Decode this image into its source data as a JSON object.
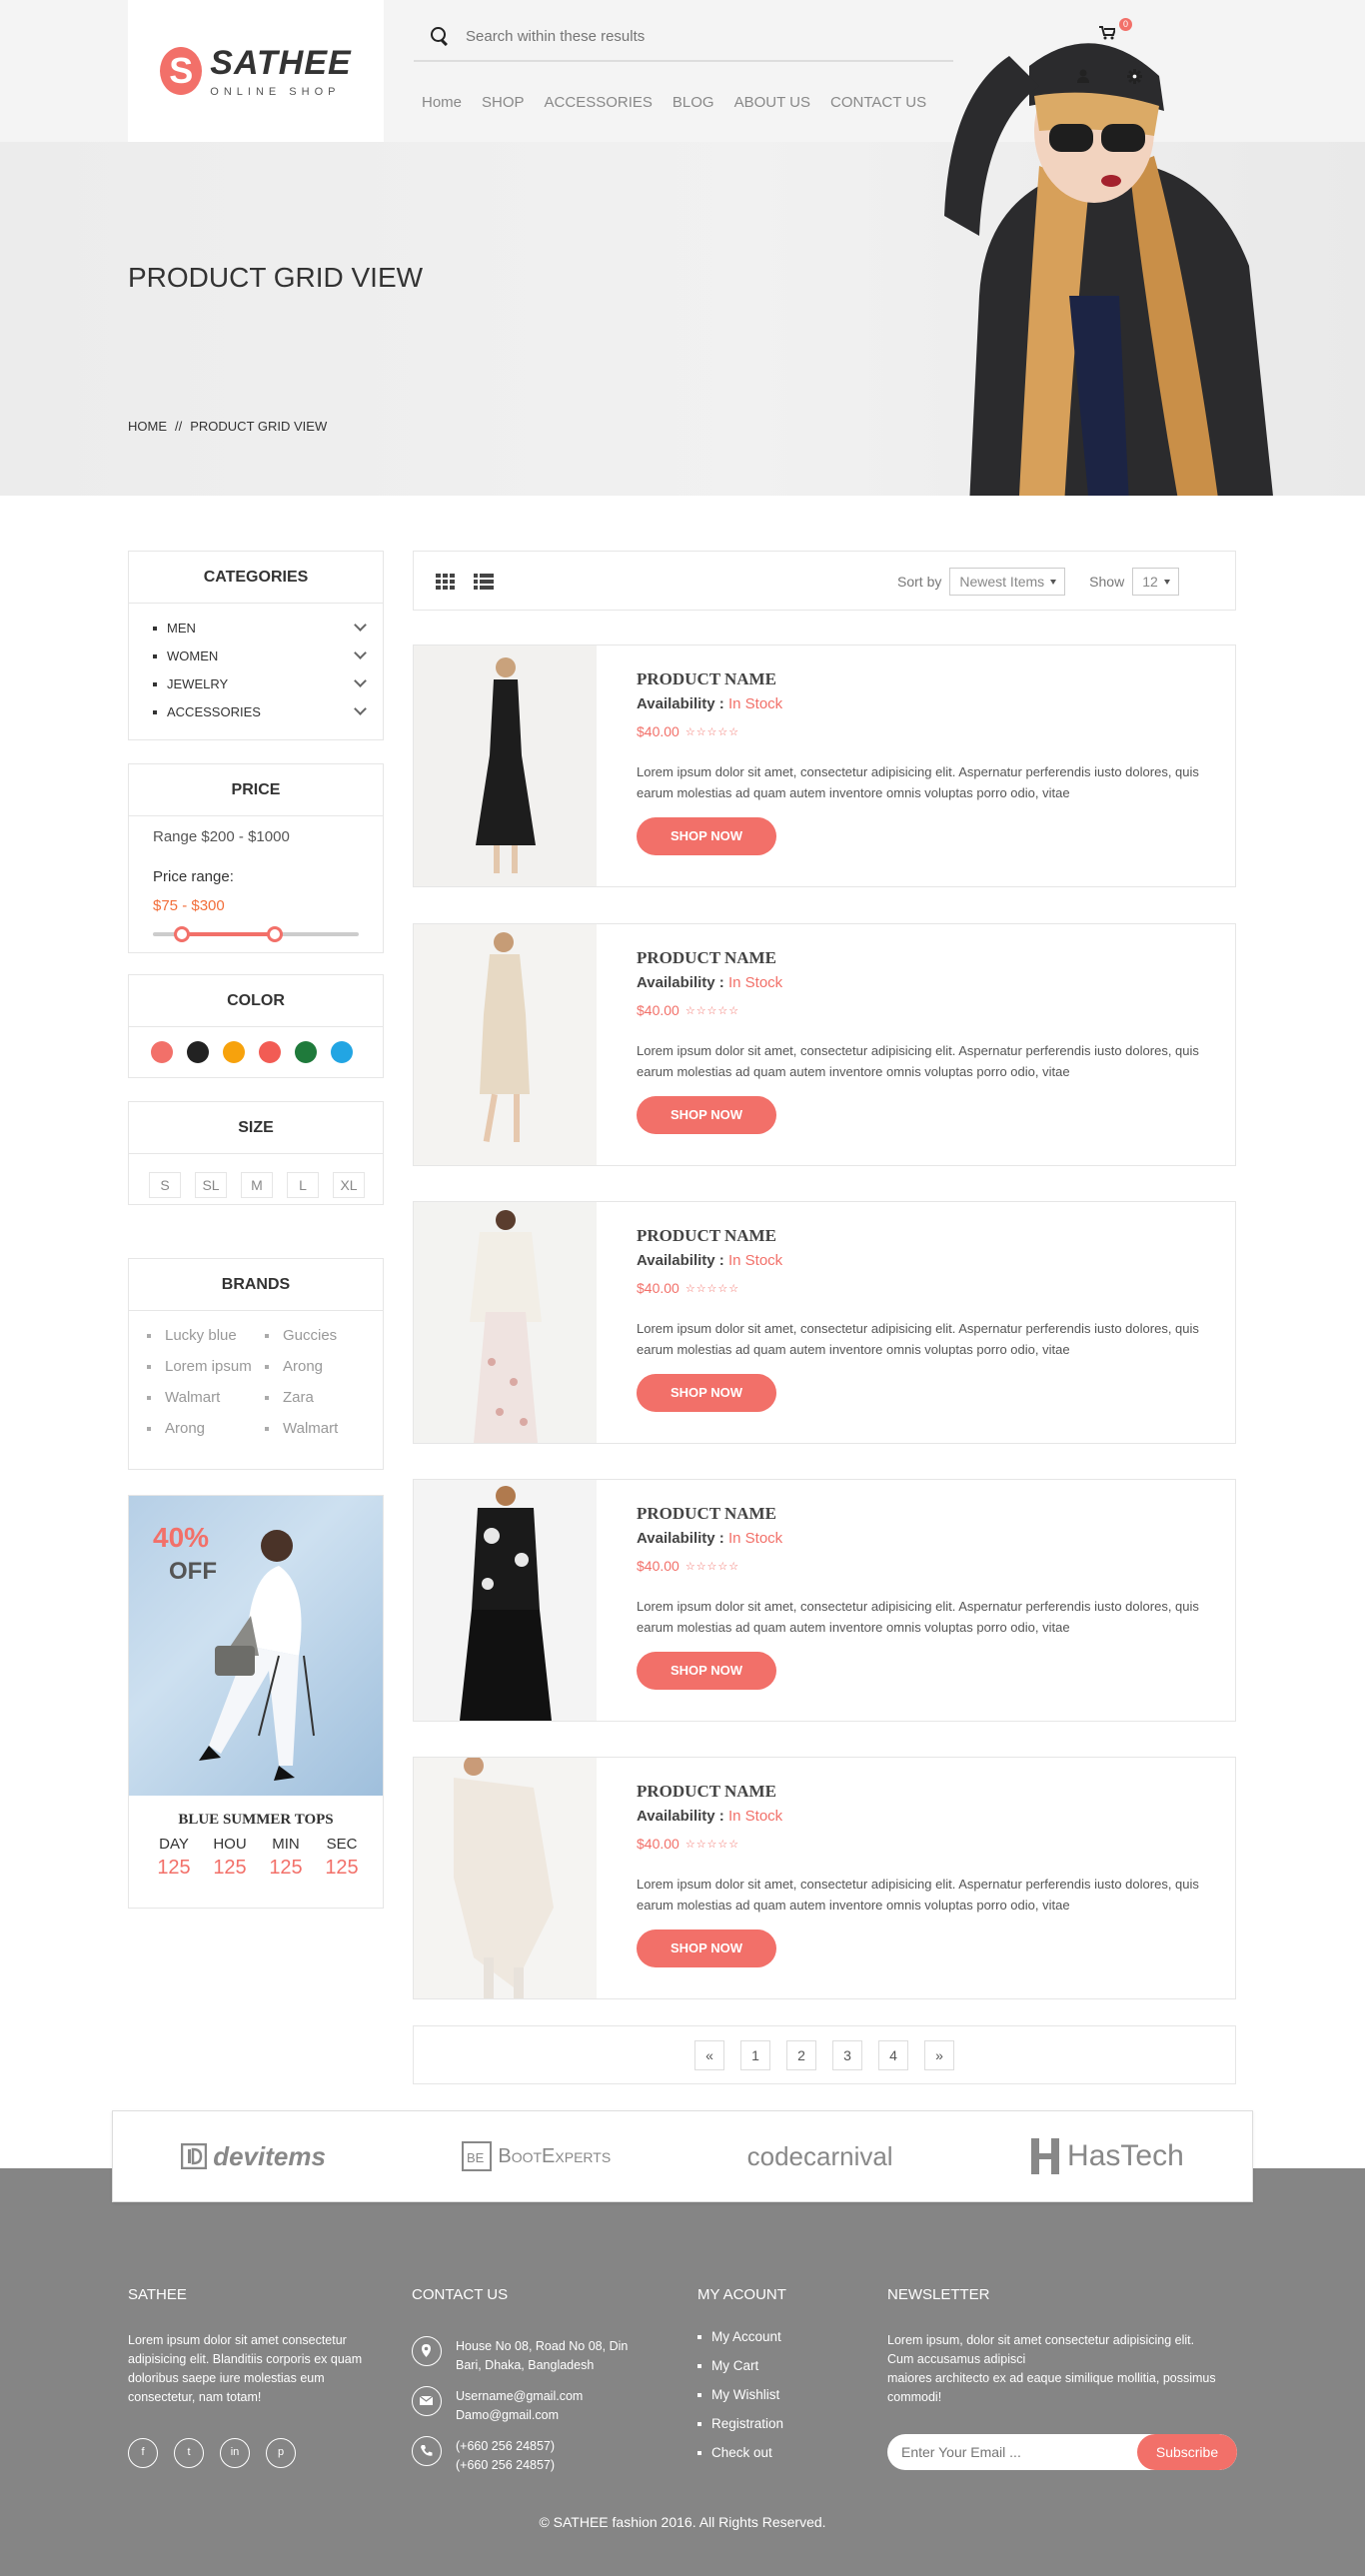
{
  "header": {
    "logo_letter": "S",
    "logo_name": "SATHEE",
    "logo_sub": "ONLINE SHOP",
    "search_placeholder": "Search within these results",
    "cart_count": "0",
    "nav": [
      "Home",
      "SHOP",
      "ACCESSORIES",
      "BLOG",
      "ABOUT US",
      "CONTACT US"
    ]
  },
  "hero": {
    "title": "PRODUCT GRID VIEW",
    "breadcrumb": [
      "HOME",
      "//",
      "PRODUCT GRID VIEW"
    ]
  },
  "sidebar": {
    "categories": {
      "title": "CATEGORIES",
      "items": [
        "MEN",
        "WOMEN",
        "JEWELRY",
        "ACCESSORIES"
      ]
    },
    "price": {
      "title": "PRICE",
      "range": "Range $200 - $1000",
      "label": "Price range:",
      "value": "$75 - $300",
      "slider_low": 0.14,
      "slider_high": 0.59
    },
    "color": {
      "title": "COLOR",
      "swatches": [
        "#f27069",
        "#222222",
        "#f7a20c",
        "#f25c54",
        "#1f7a3b",
        "#22a5e3"
      ]
    },
    "size": {
      "title": "SIZE",
      "items": [
        "S",
        "SL",
        "M",
        "L",
        "XL"
      ]
    },
    "brands": {
      "title": "BRANDS",
      "items": [
        "Lucky blue",
        "Guccies",
        "Lorem ipsum",
        "Arong",
        "Walmart",
        "Zara",
        "Arong",
        "Walmart"
      ]
    },
    "promo": {
      "percent": "40%",
      "off": "OFF",
      "title": "BLUE SUMMER TOPS",
      "units": [
        "DAY",
        "HOU",
        "MIN",
        "SEC"
      ],
      "values": [
        "125",
        "125",
        "125",
        "125"
      ]
    }
  },
  "toolbar": {
    "sort_label": "Sort by",
    "sort_value": "Newest Items",
    "show_label": "Show",
    "show_value": "12"
  },
  "products": [
    {
      "name": "PRODUCT NAME",
      "availability_label": "Availability :",
      "availability": "In Stock",
      "price": "$40.00",
      "stars": "☆☆☆☆☆",
      "desc": "Lorem ipsum dolor sit amet, consectetur adipisicing elit. Aspernatur perferendis iusto dolores, quis earum molestias ad quam autem inventore omnis voluptas porro odio, vitae",
      "button": "SHOP NOW"
    },
    {
      "name": "PRODUCT NAME",
      "availability_label": "Availability :",
      "availability": "In Stock",
      "price": "$40.00",
      "stars": "☆☆☆☆☆",
      "desc": "Lorem ipsum dolor sit amet, consectetur adipisicing elit. Aspernatur perferendis iusto dolores, quis earum molestias ad quam autem inventore omnis voluptas porro odio, vitae",
      "button": "SHOP NOW"
    },
    {
      "name": "PRODUCT NAME",
      "availability_label": "Availability :",
      "availability": "In Stock",
      "price": "$40.00",
      "stars": "☆☆☆☆☆",
      "desc": "Lorem ipsum dolor sit amet, consectetur adipisicing elit. Aspernatur perferendis iusto dolores, quis earum molestias ad quam autem inventore omnis voluptas porro odio, vitae",
      "button": "SHOP NOW"
    },
    {
      "name": "PRODUCT NAME",
      "availability_label": "Availability :",
      "availability": "In Stock",
      "price": "$40.00",
      "stars": "☆☆☆☆☆",
      "desc": "Lorem ipsum dolor sit amet, consectetur adipisicing elit. Aspernatur perferendis iusto dolores, quis earum molestias ad quam autem inventore omnis voluptas porro odio, vitae",
      "button": "SHOP NOW"
    },
    {
      "name": "PRODUCT NAME",
      "availability_label": "Availability :",
      "availability": "In Stock",
      "price": "$40.00",
      "stars": "☆☆☆☆☆",
      "desc": "Lorem ipsum dolor sit amet, consectetur adipisicing elit. Aspernatur perferendis iusto dolores, quis earum molestias ad quam autem inventore omnis voluptas porro odio, vitae",
      "button": "SHOP NOW"
    }
  ],
  "pagination": [
    "«",
    "1",
    "2",
    "3",
    "4",
    "»"
  ],
  "brand_logos": [
    "devitems",
    "BootExperts",
    "codecarnival",
    "HasTech"
  ],
  "footer": {
    "about": {
      "title": "SATHEE",
      "text": "Lorem ipsum dolor sit amet consectetur adipisicing elit. Blanditiis corporis ex quam doloribus saepe iure molestias eum consectetur, nam totam!"
    },
    "social": [
      "f",
      "t",
      "in",
      "p"
    ],
    "contact": {
      "title": "CONTACT US",
      "address": "House No 08, Road No 08, Din Bari, Dhaka, Bangladesh",
      "email1": "Username@gmail.com",
      "email2": "Damo@gmail.com",
      "phone1": "(+660 256 24857)",
      "phone2": "(+660 256 24857)"
    },
    "account": {
      "title": "MY ACOUNT",
      "items": [
        "My Account",
        "My Cart",
        "My Wishlist",
        "Registration",
        "Check out"
      ]
    },
    "newsletter": {
      "title": "NEWSLETTER",
      "line1": "Lorem ipsum, dolor sit amet consectetur adipisicing elit.",
      "line2": "Cum accusamus adipisci",
      "line3": "maiores architecto ex ad eaque similique mollitia, possimus commodi!",
      "placeholder": "Enter Your Email ...",
      "button": "Subscribe"
    },
    "copyright": "© SATHEE fashion 2016. All Rights Reserved."
  },
  "colors": {
    "accent": "#f27069",
    "price_orange": "#f26e3a",
    "footer_bg": "#858585"
  }
}
